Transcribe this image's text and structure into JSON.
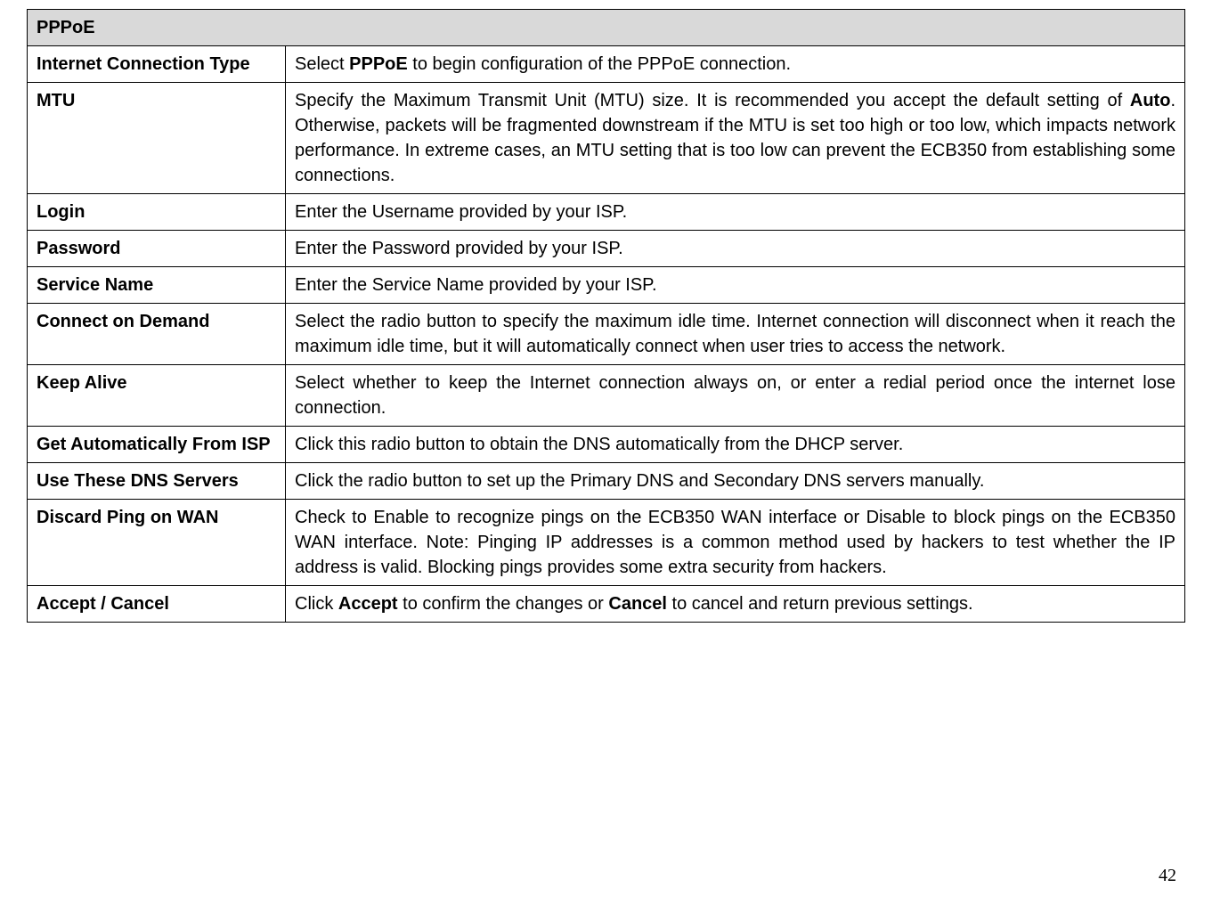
{
  "page_number": "42",
  "table": {
    "header": "PPPoE",
    "rows": [
      {
        "label": "Internet Connection Type",
        "desc_pre": "Select ",
        "desc_bold1": "PPPoE",
        "desc_post": " to begin configuration of the PPPoE connection."
      },
      {
        "label": "MTU",
        "desc_pre": "Specify the Maximum Transmit Unit (MTU) size. It is recommended you accept the default setting of ",
        "desc_bold1": "Auto",
        "desc_post": ". Otherwise, packets will be fragmented downstream if the MTU is set too high or too low, which impacts network performance. In extreme cases, an MTU setting that is too low can prevent the ECB350 from establishing some connections."
      },
      {
        "label": "Login",
        "desc_plain": "Enter the Username provided by your ISP."
      },
      {
        "label": "Password",
        "desc_plain": "Enter the Password provided by your ISP."
      },
      {
        "label": "Service Name",
        "desc_plain": "Enter the Service Name provided by your ISP."
      },
      {
        "label": "Connect on Demand",
        "desc_plain": "Select the radio button to specify the maximum idle time. Internet connection will disconnect when it reach the maximum idle time, but it will automatically connect when user tries to access the network."
      },
      {
        "label": "Keep Alive",
        "desc_plain": "Select whether to keep the Internet connection always on, or enter a redial period once the internet lose connection."
      },
      {
        "label": "Get Automatically From ISP",
        "desc_plain": "Click this radio button to obtain the DNS automatically from the DHCP server."
      },
      {
        "label": "Use These DNS Servers",
        "desc_plain": "Click the radio button to set up the Primary DNS and Secondary DNS servers manually."
      },
      {
        "label": "Discard Ping on WAN",
        "desc_plain": "Check to Enable to recognize pings on the ECB350 WAN interface or Disable to block pings on the ECB350 WAN interface. Note: Pinging IP addresses is a common method used by hackers to test whether the IP address is valid. Blocking pings provides some extra security from hackers."
      },
      {
        "label": "Accept / Cancel",
        "desc_pre": "Click ",
        "desc_bold1": "Accept",
        "desc_mid": " to confirm the changes or ",
        "desc_bold2": "Cancel",
        "desc_post": " to cancel and return previous settings."
      }
    ]
  }
}
